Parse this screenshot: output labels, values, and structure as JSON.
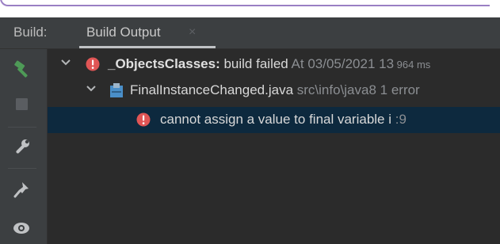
{
  "header": {
    "build_label": "Build:",
    "tab_label": "Build Output",
    "tab_close": "×"
  },
  "toolstrip": {
    "items": [
      {
        "icon": "hammer-icon",
        "color": "#4e9a57"
      },
      {
        "icon": "stop-icon",
        "color": "#5a5d61"
      },
      {
        "icon": "wrench-icon",
        "color": "#c0c2c4"
      },
      {
        "icon": "pin-icon",
        "color": "#c0c2c4"
      },
      {
        "icon": "eye-icon",
        "color": "#c0c2c4"
      }
    ]
  },
  "tree": {
    "root": {
      "project": "_ObjectsClasses:",
      "status": " build failed",
      "timestamp": " At 03/05/2021 13",
      "duration": " 964 ms",
      "error_icon": "error-icon",
      "error_color": "#e05555"
    },
    "file": {
      "name": "FinalInstanceChanged.java",
      "path": " src\\info\\java8",
      "count": " 1 error",
      "icon": "java-file-icon"
    },
    "error": {
      "message": "cannot assign a value to final variable i",
      "line": " :9"
    }
  }
}
